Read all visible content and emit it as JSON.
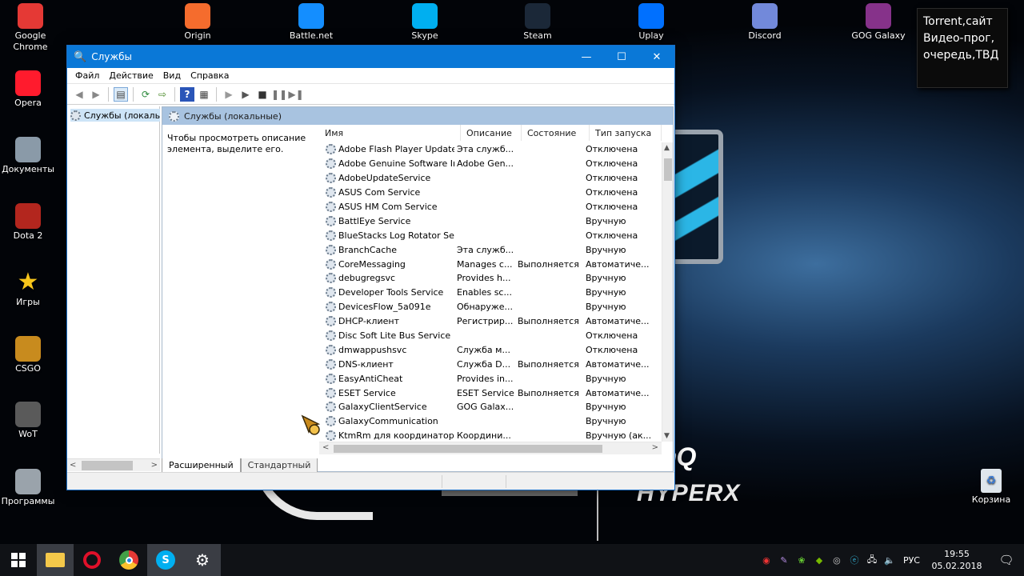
{
  "desktop": {
    "top_icons": [
      {
        "label": "Google\nChrome",
        "icon": "chrome-icon",
        "color": "#e53935"
      },
      {
        "label": "Origin",
        "icon": "origin-icon",
        "color": "#f56c2d"
      },
      {
        "label": "Battle.net",
        "icon": "battlenet-icon",
        "color": "#148eff"
      },
      {
        "label": "Skype",
        "icon": "skype-icon",
        "color": "#00aff0"
      },
      {
        "label": "Steam",
        "icon": "steam-icon",
        "color": "#1b2838"
      },
      {
        "label": "Uplay",
        "icon": "uplay-icon",
        "color": "#0070ff"
      },
      {
        "label": "Discord",
        "icon": "discord-icon",
        "color": "#7289da"
      },
      {
        "label": "GOG Galaxy",
        "icon": "gog-icon",
        "color": "#86328a"
      }
    ],
    "left_icons": [
      {
        "label": "Opera",
        "icon": "opera-icon",
        "color": "#ff1b2d"
      },
      {
        "label": "Документы",
        "icon": "documents-icon",
        "color": "#8a9aa8"
      },
      {
        "label": "Dota 2",
        "icon": "dota2-icon",
        "color": "#b3261e"
      },
      {
        "label": "Игры",
        "icon": "star-icon",
        "color": "#f7c51b"
      },
      {
        "label": "CSGO",
        "icon": "csgo-icon",
        "color": "#c88b1e"
      },
      {
        "label": "WoT",
        "icon": "wot-icon",
        "color": "#5a5a5a"
      },
      {
        "label": "Программы",
        "icon": "programs-icon",
        "color": "#9aa3ab"
      }
    ],
    "recycle_bin": {
      "label": "Корзина",
      "icon": "recycle-bin-icon"
    },
    "sticky_note": {
      "line1": "Torrent,сайт",
      "line2": "Видео-прог,",
      "line3": "очередь,ТВД"
    },
    "wallpaper": {
      "brand1": "BenQ",
      "brand2": "HYPERX"
    }
  },
  "window": {
    "title": "Службы",
    "menu": [
      "Файл",
      "Действие",
      "Вид",
      "Справка"
    ],
    "tree_item": "Службы (локалы",
    "panel_title": "Службы (локальные)",
    "description": "Чтобы просмотреть описание элемента, выделите его.",
    "columns": {
      "name": "Имя",
      "desc": "Описание",
      "state": "Состояние",
      "start": "Тип запуска"
    },
    "services": [
      {
        "name": "Adobe Flash Player Update ...",
        "desc": "Эта служб...",
        "state": "",
        "start": "Отключена"
      },
      {
        "name": "Adobe Genuine Software In...",
        "desc": "Adobe Gen...",
        "state": "",
        "start": "Отключена"
      },
      {
        "name": "AdobeUpdateService",
        "desc": "",
        "state": "",
        "start": "Отключена"
      },
      {
        "name": "ASUS Com Service",
        "desc": "",
        "state": "",
        "start": "Отключена"
      },
      {
        "name": "ASUS HM Com Service",
        "desc": "",
        "state": "",
        "start": "Отключена"
      },
      {
        "name": "BattlEye Service",
        "desc": "",
        "state": "",
        "start": "Вручную"
      },
      {
        "name": "BlueStacks Log Rotator Serv...",
        "desc": "",
        "state": "",
        "start": "Отключена"
      },
      {
        "name": "BranchCache",
        "desc": "Эта служб...",
        "state": "",
        "start": "Вручную"
      },
      {
        "name": "CoreMessaging",
        "desc": "Manages c...",
        "state": "Выполняется",
        "start": "Автоматиче..."
      },
      {
        "name": "debugregsvc",
        "desc": "Provides h...",
        "state": "",
        "start": "Вручную"
      },
      {
        "name": "Developer Tools Service",
        "desc": "Enables sc...",
        "state": "",
        "start": "Вручную"
      },
      {
        "name": "DevicesFlow_5a091e",
        "desc": "Обнаруже...",
        "state": "",
        "start": "Вручную"
      },
      {
        "name": "DHCP-клиент",
        "desc": "Регистрир...",
        "state": "Выполняется",
        "start": "Автоматиче..."
      },
      {
        "name": "Disc Soft Lite Bus Service",
        "desc": "",
        "state": "",
        "start": "Отключена"
      },
      {
        "name": "dmwappushsvc",
        "desc": "Служба м...",
        "state": "",
        "start": "Отключена"
      },
      {
        "name": "DNS-клиент",
        "desc": "Служба D...",
        "state": "Выполняется",
        "start": "Автоматиче..."
      },
      {
        "name": "EasyAntiCheat",
        "desc": "Provides in...",
        "state": "",
        "start": "Вручную"
      },
      {
        "name": "ESET Service",
        "desc": "ESET Service",
        "state": "Выполняется",
        "start": "Автоматиче..."
      },
      {
        "name": "GalaxyClientService",
        "desc": "GOG Galax...",
        "state": "",
        "start": "Вручную"
      },
      {
        "name": "GalaxyCommunication",
        "desc": "",
        "state": "",
        "start": "Вручную"
      },
      {
        "name": "KtmRm для координатора ...",
        "desc": "Координи...",
        "state": "",
        "start": "Вручную (ак..."
      }
    ],
    "tabs": [
      "Расширенный",
      "Стандартный"
    ]
  },
  "taskbar": {
    "apps": [
      {
        "icon": "windows-start-icon"
      },
      {
        "icon": "file-explorer-icon",
        "active": true
      },
      {
        "icon": "opera-icon"
      },
      {
        "icon": "chrome-icon"
      },
      {
        "icon": "skype-icon",
        "active": true
      },
      {
        "icon": "services-gear-icon",
        "active": true
      }
    ],
    "lang": "РУС",
    "time": "19:55",
    "date": "05.02.2018"
  }
}
